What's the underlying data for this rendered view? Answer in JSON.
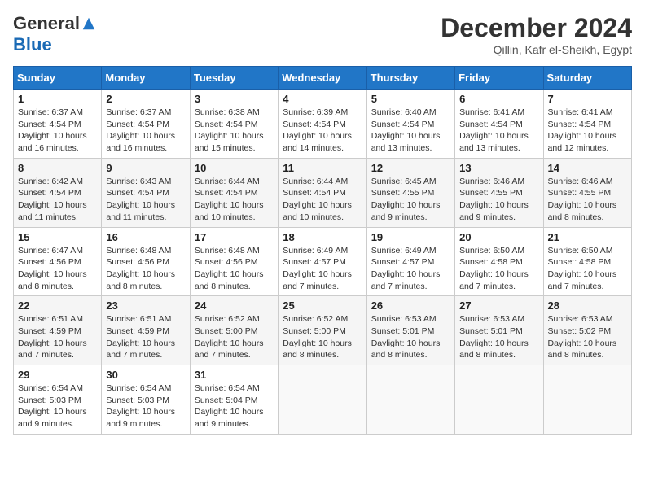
{
  "logo": {
    "general": "General",
    "blue": "Blue"
  },
  "title": {
    "month": "December 2024",
    "location": "Qillin, Kafr el-Sheikh, Egypt"
  },
  "headers": [
    "Sunday",
    "Monday",
    "Tuesday",
    "Wednesday",
    "Thursday",
    "Friday",
    "Saturday"
  ],
  "weeks": [
    [
      {
        "day": "1",
        "sunrise": "6:37 AM",
        "sunset": "4:54 PM",
        "daylight": "10 hours and 16 minutes."
      },
      {
        "day": "2",
        "sunrise": "6:37 AM",
        "sunset": "4:54 PM",
        "daylight": "10 hours and 16 minutes."
      },
      {
        "day": "3",
        "sunrise": "6:38 AM",
        "sunset": "4:54 PM",
        "daylight": "10 hours and 15 minutes."
      },
      {
        "day": "4",
        "sunrise": "6:39 AM",
        "sunset": "4:54 PM",
        "daylight": "10 hours and 14 minutes."
      },
      {
        "day": "5",
        "sunrise": "6:40 AM",
        "sunset": "4:54 PM",
        "daylight": "10 hours and 13 minutes."
      },
      {
        "day": "6",
        "sunrise": "6:41 AM",
        "sunset": "4:54 PM",
        "daylight": "10 hours and 13 minutes."
      },
      {
        "day": "7",
        "sunrise": "6:41 AM",
        "sunset": "4:54 PM",
        "daylight": "10 hours and 12 minutes."
      }
    ],
    [
      {
        "day": "8",
        "sunrise": "6:42 AM",
        "sunset": "4:54 PM",
        "daylight": "10 hours and 11 minutes."
      },
      {
        "day": "9",
        "sunrise": "6:43 AM",
        "sunset": "4:54 PM",
        "daylight": "10 hours and 11 minutes."
      },
      {
        "day": "10",
        "sunrise": "6:44 AM",
        "sunset": "4:54 PM",
        "daylight": "10 hours and 10 minutes."
      },
      {
        "day": "11",
        "sunrise": "6:44 AM",
        "sunset": "4:54 PM",
        "daylight": "10 hours and 10 minutes."
      },
      {
        "day": "12",
        "sunrise": "6:45 AM",
        "sunset": "4:55 PM",
        "daylight": "10 hours and 9 minutes."
      },
      {
        "day": "13",
        "sunrise": "6:46 AM",
        "sunset": "4:55 PM",
        "daylight": "10 hours and 9 minutes."
      },
      {
        "day": "14",
        "sunrise": "6:46 AM",
        "sunset": "4:55 PM",
        "daylight": "10 hours and 8 minutes."
      }
    ],
    [
      {
        "day": "15",
        "sunrise": "6:47 AM",
        "sunset": "4:56 PM",
        "daylight": "10 hours and 8 minutes."
      },
      {
        "day": "16",
        "sunrise": "6:48 AM",
        "sunset": "4:56 PM",
        "daylight": "10 hours and 8 minutes."
      },
      {
        "day": "17",
        "sunrise": "6:48 AM",
        "sunset": "4:56 PM",
        "daylight": "10 hours and 8 minutes."
      },
      {
        "day": "18",
        "sunrise": "6:49 AM",
        "sunset": "4:57 PM",
        "daylight": "10 hours and 7 minutes."
      },
      {
        "day": "19",
        "sunrise": "6:49 AM",
        "sunset": "4:57 PM",
        "daylight": "10 hours and 7 minutes."
      },
      {
        "day": "20",
        "sunrise": "6:50 AM",
        "sunset": "4:58 PM",
        "daylight": "10 hours and 7 minutes."
      },
      {
        "day": "21",
        "sunrise": "6:50 AM",
        "sunset": "4:58 PM",
        "daylight": "10 hours and 7 minutes."
      }
    ],
    [
      {
        "day": "22",
        "sunrise": "6:51 AM",
        "sunset": "4:59 PM",
        "daylight": "10 hours and 7 minutes."
      },
      {
        "day": "23",
        "sunrise": "6:51 AM",
        "sunset": "4:59 PM",
        "daylight": "10 hours and 7 minutes."
      },
      {
        "day": "24",
        "sunrise": "6:52 AM",
        "sunset": "5:00 PM",
        "daylight": "10 hours and 7 minutes."
      },
      {
        "day": "25",
        "sunrise": "6:52 AM",
        "sunset": "5:00 PM",
        "daylight": "10 hours and 8 minutes."
      },
      {
        "day": "26",
        "sunrise": "6:53 AM",
        "sunset": "5:01 PM",
        "daylight": "10 hours and 8 minutes."
      },
      {
        "day": "27",
        "sunrise": "6:53 AM",
        "sunset": "5:01 PM",
        "daylight": "10 hours and 8 minutes."
      },
      {
        "day": "28",
        "sunrise": "6:53 AM",
        "sunset": "5:02 PM",
        "daylight": "10 hours and 8 minutes."
      }
    ],
    [
      {
        "day": "29",
        "sunrise": "6:54 AM",
        "sunset": "5:03 PM",
        "daylight": "10 hours and 9 minutes."
      },
      {
        "day": "30",
        "sunrise": "6:54 AM",
        "sunset": "5:03 PM",
        "daylight": "10 hours and 9 minutes."
      },
      {
        "day": "31",
        "sunrise": "6:54 AM",
        "sunset": "5:04 PM",
        "daylight": "10 hours and 9 minutes."
      },
      null,
      null,
      null,
      null
    ]
  ],
  "labels": {
    "sunrise": "Sunrise:",
    "sunset": "Sunset:",
    "daylight": "Daylight:"
  }
}
